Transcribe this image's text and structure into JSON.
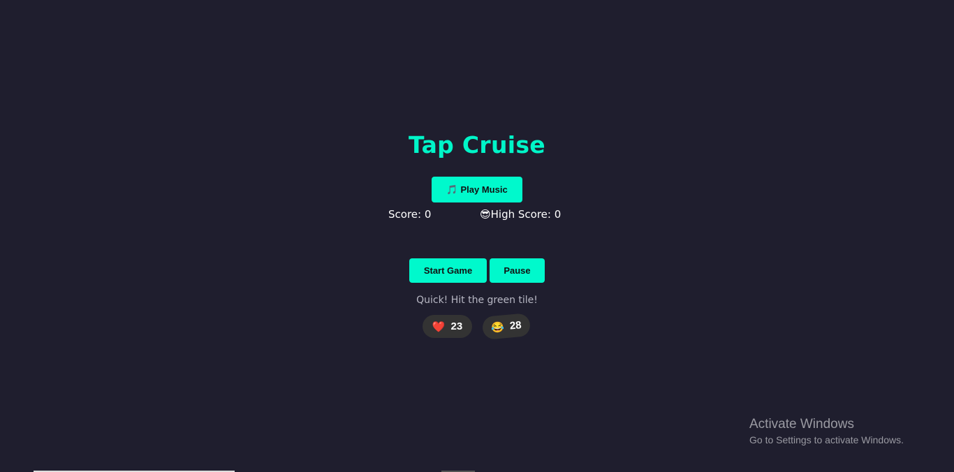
{
  "game": {
    "title": "Tap Cruise",
    "play_music_label": "Play Music",
    "music_icon": "🎵",
    "score_label": "Score: 0",
    "high_score_icon": "😎",
    "high_score_label": "High Score: 0",
    "start_label": "Start Game",
    "pause_label": "Pause",
    "message": "Quick! Hit the green tile!",
    "reactions": [
      {
        "icon": "❤️",
        "count": "23"
      },
      {
        "icon": "😂",
        "count": "28"
      }
    ]
  },
  "watermark": {
    "title": "Activate Windows",
    "subtitle": "Go to Settings to activate Windows."
  },
  "colors": {
    "accent": "#00f9cc",
    "background": "#1f1e2e"
  }
}
